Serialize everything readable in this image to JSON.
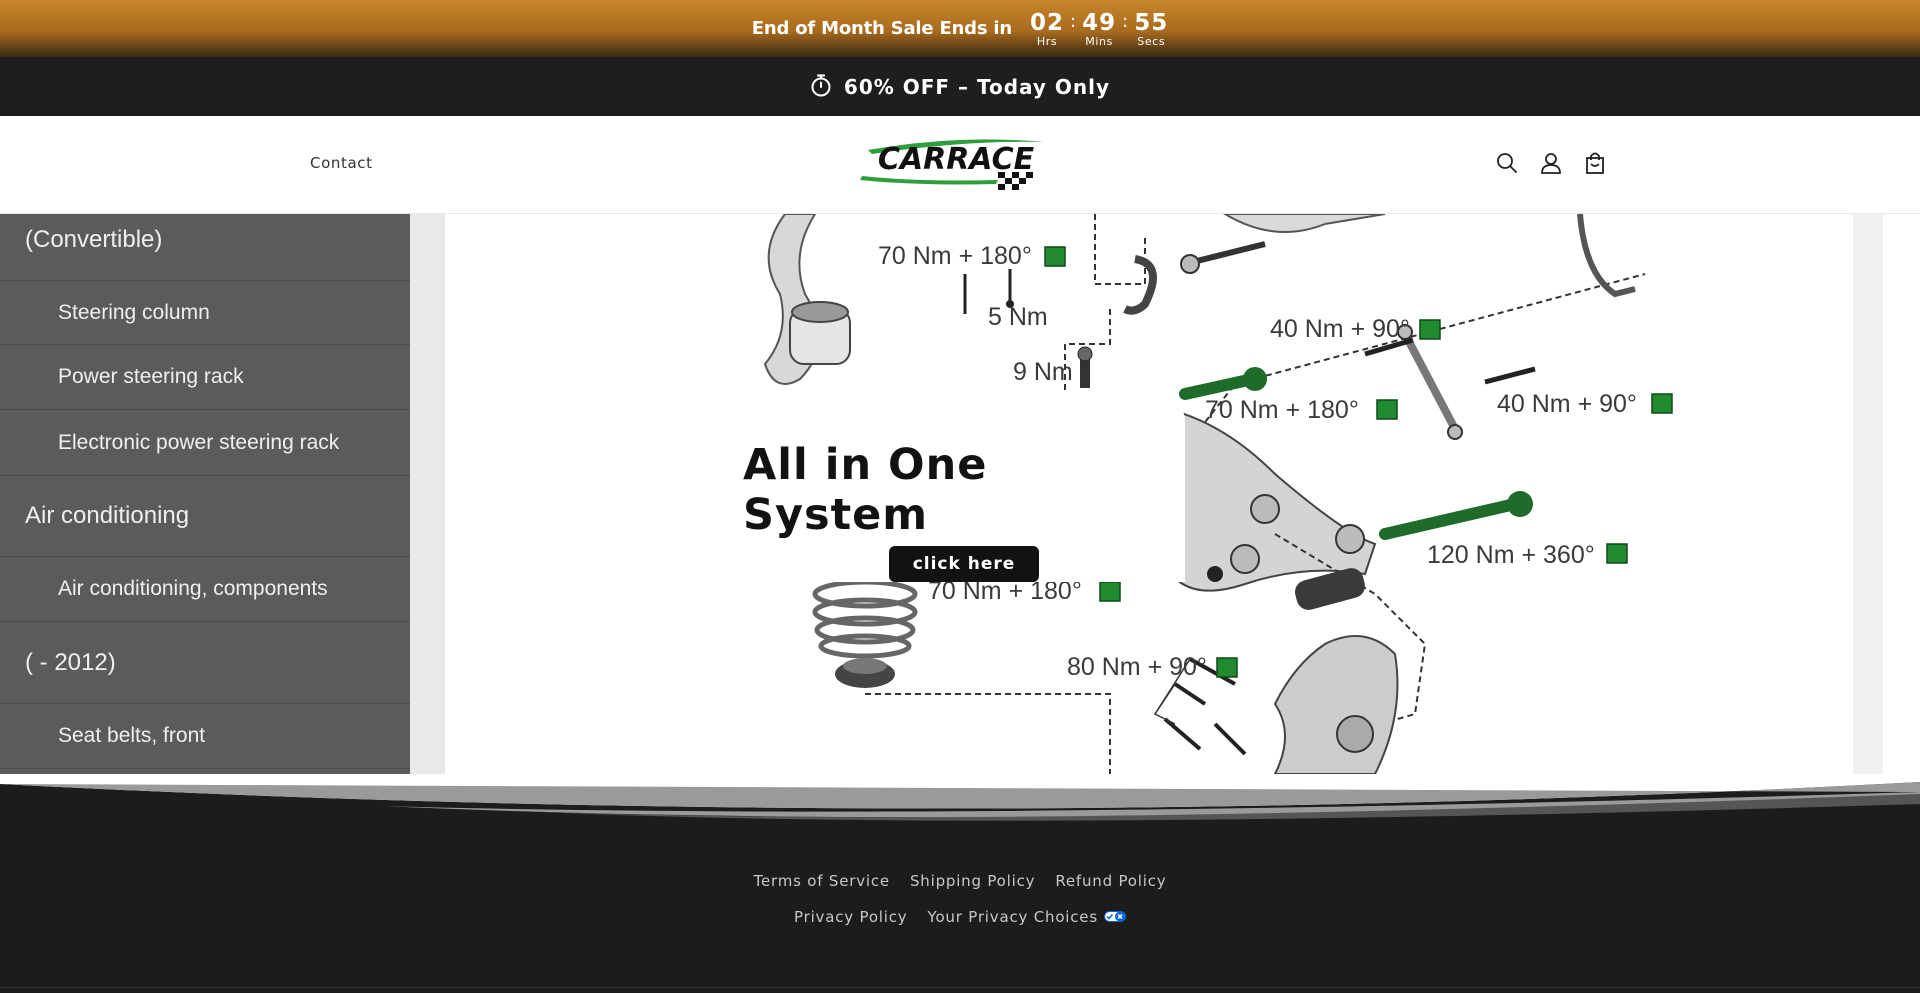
{
  "countdown": {
    "text": "End of Month Sale Ends in",
    "hours": "02",
    "hours_label": "Hrs",
    "minutes": "49",
    "minutes_label": "Mins",
    "seconds": "55",
    "seconds_label": "Secs",
    "separator": ":"
  },
  "promo": {
    "text": "60% OFF – Today Only",
    "icon": "stopwatch-icon"
  },
  "header": {
    "nav": {
      "contact_label": "Contact"
    },
    "logo_text": "CARRACE",
    "icons": [
      "search-icon",
      "account-icon",
      "cart-icon"
    ]
  },
  "hero": {
    "title": "All in One System",
    "button_label": "click here",
    "sidebar": [
      {
        "label": "(Convertible)",
        "level": "head"
      },
      {
        "label": "Steering column",
        "level": "sub"
      },
      {
        "label": "Power steering rack",
        "level": "sub"
      },
      {
        "label": "Electronic power steering rack",
        "level": "sub"
      },
      {
        "label": "Air conditioning",
        "level": "head"
      },
      {
        "label": "Air conditioning, components",
        "level": "sub"
      },
      {
        "label": "( - 2012)",
        "level": "head"
      },
      {
        "label": "Seat belts, front",
        "level": "sub"
      }
    ],
    "diagram_labels": [
      "70 Nm + 180°",
      "5 Nm",
      "9 Nm",
      "40 Nm + 90°",
      "70 Nm + 180°",
      "40 Nm + 90°",
      "120 Nm + 360°",
      "70 Nm + 180°",
      "80 Nm + 90°"
    ]
  },
  "footer": {
    "links_row1": [
      "Terms of Service",
      "Shipping Policy",
      "Refund Policy"
    ],
    "privacy_policy": "Privacy Policy",
    "privacy_choices": "Your Privacy Choices"
  },
  "colors": {
    "accent": "#c8862b",
    "dark": "#1c1c1c",
    "torque_green": "#1f8a2e"
  }
}
